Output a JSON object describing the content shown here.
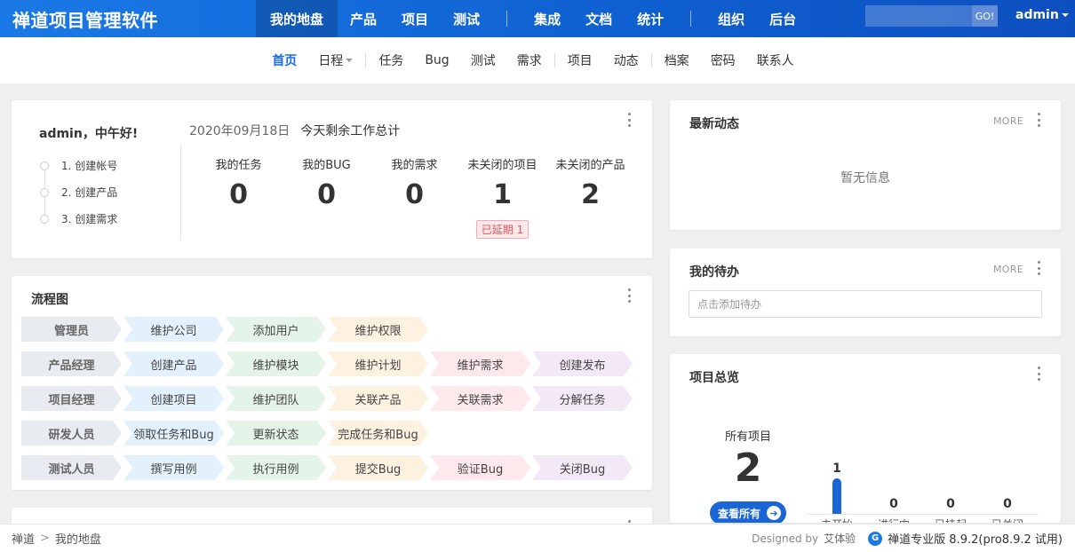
{
  "app": {
    "title": "禅道项目管理软件"
  },
  "main_nav": [
    {
      "label": "我的地盘",
      "active": true
    },
    {
      "label": "产品"
    },
    {
      "label": "项目"
    },
    {
      "label": "测试"
    },
    {
      "label": "集成"
    },
    {
      "label": "文档"
    },
    {
      "label": "统计"
    },
    {
      "label": "组织"
    },
    {
      "label": "后台"
    }
  ],
  "search": {
    "placeholder": "",
    "go_label": "GO!"
  },
  "user": {
    "name": "admin"
  },
  "sub_nav": [
    {
      "label": "首页",
      "active": true
    },
    {
      "label": "日程",
      "dropdown": true
    },
    {
      "label": "任务"
    },
    {
      "label": "Bug"
    },
    {
      "label": "测试"
    },
    {
      "label": "需求"
    },
    {
      "label": "项目"
    },
    {
      "label": "动态"
    },
    {
      "label": "档案"
    },
    {
      "label": "密码"
    },
    {
      "label": "联系人"
    }
  ],
  "welcome": {
    "greeting": "admin，中午好!",
    "steps": [
      "1. 创建帐号",
      "2. 创建产品",
      "3. 创建需求"
    ],
    "date": "2020年09月18日",
    "summary_title": "今天剩余工作总计",
    "stats": [
      {
        "label": "我的任务",
        "value": "0"
      },
      {
        "label": "我的BUG",
        "value": "0"
      },
      {
        "label": "我的需求",
        "value": "0"
      },
      {
        "label": "未关闭的项目",
        "value": "1",
        "badge": "已延期 1"
      },
      {
        "label": "未关闭的产品",
        "value": "2"
      }
    ]
  },
  "flow": {
    "title": "流程图",
    "colors": {
      "role": "#e8ecf1",
      "blue": "#e3f1fc",
      "green": "#e5f4e8",
      "orange": "#fdf1e0",
      "pink": "#fde9ec",
      "purple": "#f3e8f6"
    },
    "rows": [
      {
        "role": "管理员",
        "steps": [
          "维护公司",
          "添加用户",
          "维护权限"
        ]
      },
      {
        "role": "产品经理",
        "steps": [
          "创建产品",
          "维护模块",
          "维护计划",
          "维护需求",
          "创建发布"
        ]
      },
      {
        "role": "项目经理",
        "steps": [
          "创建项目",
          "维护团队",
          "关联产品",
          "关联需求",
          "分解任务"
        ]
      },
      {
        "role": "研发人员",
        "steps": [
          "领取任务和Bug",
          "更新状态",
          "完成任务和Bug"
        ]
      },
      {
        "role": "测试人员",
        "steps": [
          "撰写用例",
          "执行用例",
          "提交Bug",
          "验证Bug",
          "关闭Bug"
        ]
      }
    ]
  },
  "dynamics": {
    "title": "最新动态",
    "more": "MORE",
    "empty": "暂无信息"
  },
  "todo": {
    "title": "我的待办",
    "more": "MORE",
    "placeholder": "点击添加待办"
  },
  "project_overview": {
    "title": "项目总览",
    "all_label": "所有项目",
    "all_count": "2",
    "view_all": "查看所有",
    "chart_data": {
      "type": "bar",
      "categories": [
        "未开始",
        "进行中",
        "已挂起",
        "已关闭"
      ],
      "values": [
        1,
        0,
        0,
        0
      ],
      "color": "#1a66d6"
    }
  },
  "footer": {
    "breadcrumb": [
      "禅道",
      "我的地盘"
    ],
    "designed_by": "Designed by",
    "designer": "艾体验",
    "version": "禅道专业版 8.9.2(pro8.9.2 试用)"
  }
}
